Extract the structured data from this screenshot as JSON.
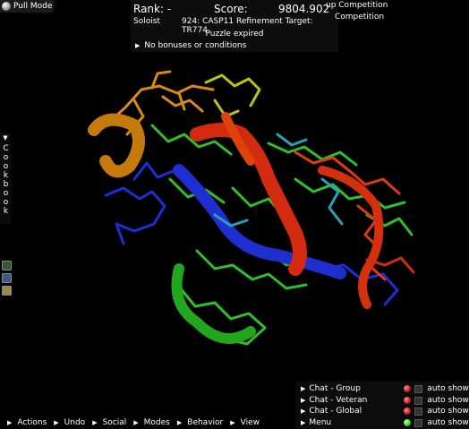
{
  "pull_mode": {
    "label": "Pull Mode"
  },
  "score_panel": {
    "rank": "Rank: -",
    "score_label": "Score:",
    "score_value": "9804.902",
    "player": "Soloist",
    "puzzle": "924: CASP11 Refinement Target: TR774",
    "status": "Puzzle expired",
    "bonuses": "No bonuses or conditions"
  },
  "competition": {
    "line1": "up Competition",
    "line2": "Competition"
  },
  "cookbook": {
    "title": "Cookbook"
  },
  "chat": [
    {
      "label": "Chat - Group",
      "dot": "red",
      "auto_show": "auto show"
    },
    {
      "label": "Chat - Veteran",
      "dot": "red",
      "auto_show": "auto show"
    },
    {
      "label": "Chat - Global",
      "dot": "red",
      "auto_show": "auto show"
    },
    {
      "label": "Menu",
      "dot": "green",
      "auto_show": "auto show"
    }
  ],
  "toolbar": {
    "actions": "Actions",
    "undo": "Undo",
    "social": "Social",
    "modes": "Modes",
    "behavior": "Behavior",
    "view": "View"
  }
}
